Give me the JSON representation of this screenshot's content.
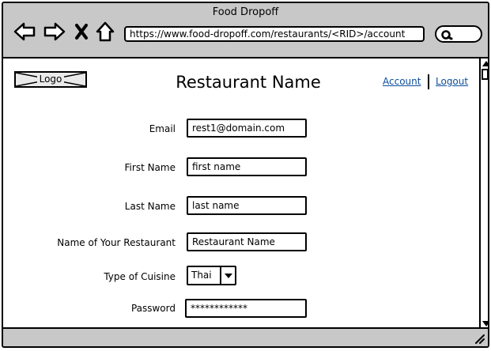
{
  "window": {
    "title": "Food Dropoff"
  },
  "browser": {
    "url": "https://www.food-dropoff.com/restaurants/<RID>/account",
    "buttons": [
      "back-icon",
      "forward-icon",
      "close-icon",
      "home-icon",
      "search-icon"
    ]
  },
  "header": {
    "logo_label": "Logo",
    "title": "Restaurant Name",
    "account_link": "Account",
    "logout_link": "Logout"
  },
  "form": {
    "email": {
      "label": "Email",
      "value": "rest1@domain.com"
    },
    "first_name": {
      "label": "First Name",
      "value": "first name"
    },
    "last_name": {
      "label": "Last Name",
      "value": "last name"
    },
    "restaurant_name": {
      "label": "Name of Your Restaurant",
      "value": "Restaurant Name"
    },
    "cuisine": {
      "label": "Type of Cuisine",
      "selected": "Thai"
    },
    "password": {
      "label": "Password",
      "value": "************"
    }
  }
}
